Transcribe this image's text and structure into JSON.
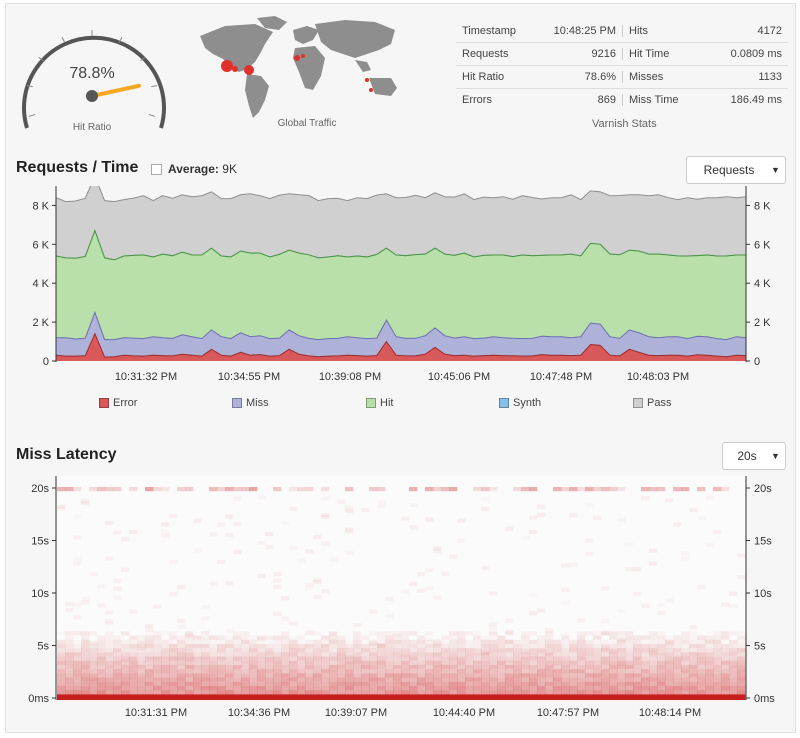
{
  "gauge": {
    "value_text": "78.8%",
    "label": "Hit Ratio",
    "value": 78.8
  },
  "map": {
    "label": "Global Traffic"
  },
  "stats": {
    "title": "Varnish Stats",
    "rows": [
      {
        "l_label": "Timestamp",
        "l_value": "10:48:25 PM",
        "r_label": "Hits",
        "r_value": "4172"
      },
      {
        "l_label": "Requests",
        "l_value": "9216",
        "r_label": "Hit Time",
        "r_value": "0.0809 ms"
      },
      {
        "l_label": "Hit Ratio",
        "l_value": "78.6%",
        "r_label": "Misses",
        "r_value": "1133"
      },
      {
        "l_label": "Errors",
        "l_value": "869",
        "r_label": "Miss Time",
        "r_value": "186.49 ms"
      }
    ]
  },
  "requests_section": {
    "title": "Requests / Time",
    "average_label": "Average:",
    "average_value": "9K",
    "select_value": "Requests"
  },
  "latency_section": {
    "title": "Miss Latency",
    "select_value": "20s"
  },
  "colors": {
    "error": "#d9585a",
    "miss": "#aeb1d8",
    "hit": "#b9dfab",
    "synth": "#87bfeb",
    "pass": "#d0d0d0",
    "gauge_needle": "#f5a623"
  },
  "chart_data": [
    {
      "type": "area",
      "stacked": true,
      "yticks": [
        "0",
        "2 K",
        "4 K",
        "6 K",
        "8 K"
      ],
      "ylim": [
        0,
        9000
      ],
      "xticks": [
        "10:31:32 PM",
        "10:34:55 PM",
        "10:39:08 PM",
        "10:45:06 PM",
        "10:47:48 PM",
        "10:48:03 PM"
      ],
      "legend": [
        "Error",
        "Miss",
        "Hit",
        "Synth",
        "Pass"
      ],
      "series": [
        {
          "name": "Error",
          "values": [
            300,
            250,
            250,
            270,
            1400,
            200,
            220,
            300,
            260,
            250,
            300,
            280,
            260,
            350,
            300,
            250,
            600,
            300,
            250,
            450,
            300,
            330,
            250,
            280,
            600,
            350,
            260,
            220,
            250,
            260,
            300,
            280,
            250,
            280,
            1000,
            300,
            260,
            270,
            350,
            700,
            350,
            280,
            300,
            250,
            280,
            300,
            280,
            270,
            250,
            260,
            330,
            300,
            300,
            280,
            300,
            850,
            800,
            300,
            260,
            600,
            450,
            300,
            280,
            300,
            300,
            250,
            320,
            300,
            250,
            220,
            300,
            280
          ]
        },
        {
          "name": "Miss",
          "values": [
            900,
            950,
            880,
            900,
            1100,
            900,
            880,
            900,
            920,
            900,
            950,
            920,
            900,
            1000,
            950,
            900,
            1000,
            950,
            900,
            1000,
            950,
            970,
            900,
            900,
            1000,
            950,
            900,
            880,
            900,
            900,
            950,
            920,
            900,
            900,
            1100,
            950,
            900,
            900,
            950,
            1000,
            950,
            900,
            950,
            900,
            900,
            950,
            920,
            900,
            900,
            900,
            950,
            950,
            950,
            920,
            950,
            1100,
            1100,
            950,
            900,
            1000,
            1000,
            950,
            920,
            950,
            950,
            900,
            950,
            950,
            900,
            880,
            950,
            920
          ]
        },
        {
          "name": "Hit",
          "values": [
            4200,
            4100,
            4150,
            4200,
            4200,
            4200,
            4100,
            4200,
            4250,
            4300,
            4100,
            4300,
            4250,
            4250,
            4200,
            4300,
            4200,
            4150,
            4200,
            4200,
            4300,
            4250,
            4200,
            4300,
            4100,
            4250,
            4300,
            4200,
            4200,
            4250,
            4100,
            4200,
            4200,
            4300,
            3700,
            4200,
            4250,
            4300,
            4200,
            4100,
            4200,
            4250,
            4300,
            4200,
            4250,
            4200,
            4250,
            4200,
            4300,
            4250,
            4150,
            4200,
            4200,
            4300,
            4150,
            4100,
            4100,
            4250,
            4300,
            4100,
            4200,
            4250,
            4300,
            4200,
            4150,
            4250,
            4150,
            4200,
            4250,
            4300,
            4200,
            4250
          ]
        },
        {
          "name": "Synth",
          "values": [
            0,
            0,
            0,
            0,
            0,
            0,
            0,
            0,
            0,
            0,
            0,
            0,
            0,
            0,
            0,
            0,
            0,
            0,
            0,
            0,
            0,
            0,
            0,
            0,
            0,
            0,
            0,
            0,
            0,
            0,
            0,
            0,
            0,
            0,
            0,
            0,
            0,
            0,
            0,
            0,
            0,
            0,
            0,
            0,
            0,
            0,
            0,
            0,
            0,
            0,
            0,
            0,
            0,
            0,
            0,
            0,
            0,
            0,
            0,
            0,
            0,
            0,
            0,
            0,
            0,
            0,
            0,
            0,
            0,
            0,
            0,
            0
          ]
        },
        {
          "name": "Pass",
          "values": [
            3000,
            2900,
            2950,
            3000,
            2800,
            2950,
            3000,
            2900,
            2950,
            3050,
            2900,
            3000,
            2950,
            2950,
            3000,
            3050,
            2900,
            2950,
            3000,
            2900,
            3050,
            2950,
            3000,
            3050,
            2900,
            3000,
            3050,
            2950,
            3000,
            2950,
            2900,
            3000,
            3000,
            3050,
            2800,
            2950,
            3000,
            3050,
            2900,
            2850,
            2950,
            3000,
            3050,
            2950,
            3000,
            2950,
            3000,
            2950,
            3050,
            3000,
            2900,
            2950,
            2950,
            3050,
            2900,
            2700,
            2700,
            3000,
            3050,
            2850,
            2900,
            3000,
            3050,
            2950,
            2900,
            3000,
            2900,
            2950,
            3000,
            3050,
            2950,
            3000
          ]
        }
      ]
    },
    {
      "type": "heatmap",
      "yticks": [
        "0ms",
        "5s",
        "10s",
        "15s",
        "20s"
      ],
      "ylim": [
        0,
        20
      ],
      "xticks": [
        "10:31:31 PM",
        "10:34:36 PM",
        "10:39:07 PM",
        "10:44:40 PM",
        "10:47:57 PM",
        "10:48:14 PM"
      ]
    }
  ]
}
